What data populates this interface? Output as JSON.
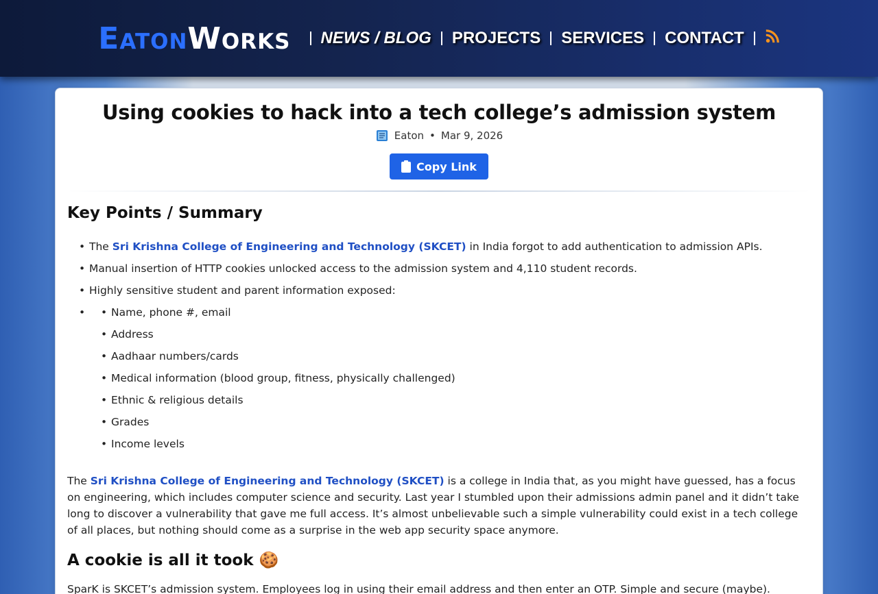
{
  "header": {
    "logo_part1": "Eaton",
    "logo_part2": "Works",
    "nav": [
      "NEWS / BLOG",
      "PROJECTS",
      "SERVICES",
      "CONTACT"
    ],
    "rss_icon": "rss-icon",
    "accent_color": "#2b6fff"
  },
  "article": {
    "title": "Using cookies to hack into a tech college’s admission system",
    "author": "Eaton",
    "date": "Mar 9, 2026",
    "copy_label": "Copy Link",
    "summary_heading": "Key Points / Summary",
    "points": {
      "p1_pre": "The",
      "p1_link": "Sri Krishna College of Engineering and Technology (SKCET)",
      "p1_post": "in India forgot to add authentication to admission APIs.",
      "p2": "Manual insertion of HTTP cookies unlocked access to the admission system and 4,110 student records.",
      "p3": "Highly sensitive student and parent information exposed:",
      "sub": [
        "Name, phone #, email",
        "Address",
        "Aadhaar numbers/cards",
        "Medical information (blood group, fitness, physically challenged)",
        "Ethnic & religious details",
        "Grades",
        "Income levels"
      ]
    },
    "para1_pre": "The",
    "para1_link": "Sri Krishna College of Engineering and Technology (SKCET)",
    "para1_post": "is a college in India that, as you might have guessed, has a focus on engineering, which includes computer science and security. Last year I stumbled upon their admissions admin panel and it didn’t take long to discover a vulnerability that gave me full access. It’s almost unbelievable such a simple vulnerability could exist in a tech college of all places, but nothing should come as a surprise in the web app security space anymore.",
    "heading2": "A cookie is all it took 🍪",
    "para2": "SparK is SKCET’s admission system. Employees log in using their email address and then enter an OTP. Simple and secure (maybe)."
  }
}
